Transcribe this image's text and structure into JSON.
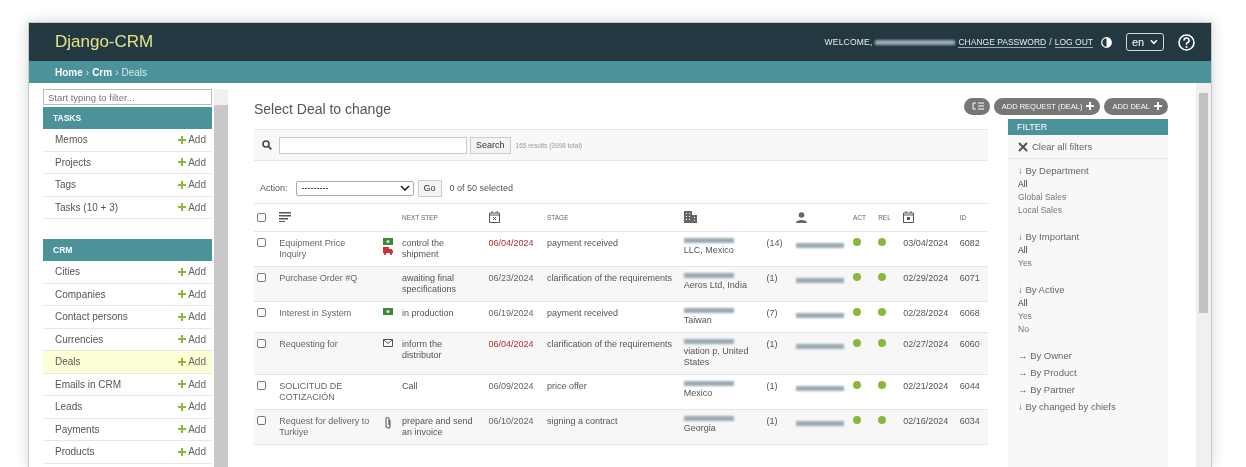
{
  "header": {
    "brand": "Django-CRM",
    "welcome": "WELCOME,",
    "change_password": "CHANGE PASSWORD",
    "separator": "/",
    "log_out": "LOG OUT",
    "language": "en"
  },
  "breadcrumbs": {
    "separator": "›",
    "items": [
      {
        "label": "Home",
        "current": false
      },
      {
        "label": "Crm",
        "current": false
      },
      {
        "label": "Deals",
        "current": true
      }
    ]
  },
  "sidebar": {
    "filter_placeholder": "Start typing to filter...",
    "sections": [
      {
        "title": "TASKS",
        "items": [
          {
            "label": "Memos",
            "add": "Add",
            "selected": false
          },
          {
            "label": "Projects",
            "add": "Add",
            "selected": false
          },
          {
            "label": "Tags",
            "add": "Add",
            "selected": false
          },
          {
            "label": "Tasks (10 + 3)",
            "add": "Add",
            "selected": false
          }
        ]
      },
      {
        "title": "CRM",
        "items": [
          {
            "label": "Cities",
            "add": "Add",
            "selected": false
          },
          {
            "label": "Companies",
            "add": "Add",
            "selected": false
          },
          {
            "label": "Contact persons",
            "add": "Add",
            "selected": false
          },
          {
            "label": "Currencies",
            "add": "Add",
            "selected": false
          },
          {
            "label": "Deals",
            "add": "Add",
            "selected": true
          },
          {
            "label": "Emails in CRM",
            "add": "Add",
            "selected": false
          },
          {
            "label": "Leads",
            "add": "Add",
            "selected": false
          },
          {
            "label": "Payments",
            "add": "Add",
            "selected": false
          },
          {
            "label": "Products",
            "add": "Add",
            "selected": false
          }
        ]
      }
    ]
  },
  "page_title": "Select Deal to change",
  "object_tools": [
    {
      "kind": "columns"
    },
    {
      "kind": "add",
      "label": "ADD REQUEST (DEAL)"
    },
    {
      "kind": "add",
      "label": "ADD DEAL"
    }
  ],
  "search": {
    "button": "Search",
    "results": "165 results (3998 total)"
  },
  "actions": {
    "label": "Action:",
    "value": "---------",
    "go": "Go",
    "selected_count": "0 of 50 selected"
  },
  "table": {
    "select_all": {
      "checked": false
    },
    "columns": [
      {
        "kind": "checkbox"
      },
      {
        "kind": "icon"
      },
      {
        "kind": "blank"
      },
      {
        "kind": "text",
        "label": "NEXT STEP"
      },
      {
        "kind": "icon"
      },
      {
        "kind": "text",
        "label": "STAGE"
      },
      {
        "kind": "icon"
      },
      {
        "kind": "blank"
      },
      {
        "kind": "icon"
      },
      {
        "kind": "text",
        "label": "ACT"
      },
      {
        "kind": "text",
        "label": "REL"
      },
      {
        "kind": "icon"
      },
      {
        "kind": "text",
        "label": "ID"
      }
    ],
    "rows": [
      {
        "checked": false,
        "title": "Equipment Price Inquiry",
        "icons": [
          {
            "kind": "money"
          },
          {
            "kind": "truck"
          }
        ],
        "next_step": "control the shipment",
        "next_step_date": "06/04/2024",
        "overdue": true,
        "stage": "payment received",
        "company": "LLC, Mexico",
        "count": "(14)",
        "act": true,
        "rel": true,
        "created": "03/04/2024",
        "id": "6082"
      },
      {
        "checked": false,
        "title": "Purchase Order #Q",
        "icons": [],
        "next_step": "awaiting final specifications",
        "next_step_date": "06/23/2024",
        "overdue": false,
        "stage": "clarification of the requirements",
        "company": "Aeros Ltd, India",
        "count": "(1)",
        "act": true,
        "rel": true,
        "created": "02/29/2024",
        "id": "6071"
      },
      {
        "checked": false,
        "title": "Interest in System",
        "icons": [
          {
            "kind": "money"
          }
        ],
        "next_step": "in production",
        "next_step_date": "06/19/2024",
        "overdue": false,
        "stage": "payment received",
        "company": "Taiwan",
        "count": "(7)",
        "act": true,
        "rel": true,
        "created": "02/28/2024",
        "id": "6068"
      },
      {
        "checked": false,
        "title": "Requesting for",
        "icons": [
          {
            "kind": "mail"
          }
        ],
        "next_step": "inform the distributor",
        "next_step_date": "06/04/2024",
        "overdue": true,
        "stage": "clarification of the requirements",
        "company": "viation p, United States",
        "count": "(1)",
        "act": true,
        "rel": true,
        "created": "02/27/2024",
        "id": "6060"
      },
      {
        "checked": false,
        "title": "SOLICITUD DE COTIZACIÓN",
        "icons": [],
        "next_step": "Call",
        "next_step_date": "06/09/2024",
        "overdue": false,
        "stage": "price offer",
        "company": "Mexico",
        "count": "(1)",
        "act": true,
        "rel": true,
        "created": "02/21/2024",
        "id": "6044"
      },
      {
        "checked": false,
        "title": "Request for delivery to Turkiye",
        "icons": [
          {
            "kind": "clip"
          }
        ],
        "next_step": "prepare and send an invoice",
        "next_step_date": "06/10/2024",
        "overdue": false,
        "stage": "signing a contract",
        "company": "Georgia",
        "count": "(1)",
        "act": true,
        "rel": true,
        "created": "02/16/2024",
        "id": "6034"
      }
    ]
  },
  "filter": {
    "title": "FILTER",
    "clear": "Clear all filters",
    "groups": [
      {
        "title": "↓ By Department",
        "options": [
          {
            "label": "All",
            "selected": true
          },
          {
            "label": "Global Sales",
            "selected": false
          },
          {
            "label": "Local Sales",
            "selected": false
          }
        ]
      },
      {
        "title": "↓ By Important",
        "options": [
          {
            "label": "All",
            "selected": true
          },
          {
            "label": "Yes",
            "selected": false
          }
        ]
      },
      {
        "title": "↓ By Active",
        "options": [
          {
            "label": "All",
            "selected": true
          },
          {
            "label": "Yes",
            "selected": false
          },
          {
            "label": "No",
            "selected": false
          }
        ]
      },
      {
        "title": "→ By Owner"
      },
      {
        "title": "→ By Product"
      },
      {
        "title": "→ By Partner"
      },
      {
        "title": "↓ By changed by chiefs"
      }
    ]
  }
}
